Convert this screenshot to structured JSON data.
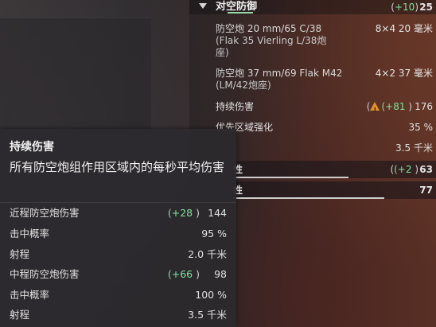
{
  "header": {
    "title": "对空防御",
    "bonus_prefix": "(",
    "bonus": "+10",
    "bonus_suffix": ")",
    "value": "25"
  },
  "guns": [
    {
      "name_line1": "防空炮 20 mm/65 C/38",
      "name_line2": "(Flak 35 Vierling L/38炮",
      "name_line3": "座)",
      "count": "8×4",
      "range": "20 毫米"
    },
    {
      "name_line1": "防空炮 37 mm/69 Flak M42",
      "name_line2": "(LM/42炮座)",
      "count": "4×2",
      "range": "37 毫米"
    }
  ],
  "stats": {
    "continuous_damage": {
      "label": "持续伤害",
      "open": "(",
      "bonus": "(+81",
      "close": ")",
      "value": "176"
    },
    "priority": {
      "label": "优先区域强化",
      "value": "35 %"
    },
    "range_row": {
      "label": "",
      "value": "3.5 千米"
    },
    "maneuverability": {
      "label": "性",
      "bonus": "(+2",
      "close": ")",
      "value": "63"
    },
    "concealment": {
      "label": "性",
      "value": "77"
    }
  },
  "tooltip": {
    "title": "持续伤害",
    "description": "所有防空炮组作用区域内的每秒平均伤害",
    "rows": [
      {
        "label": "近程防空炮伤害",
        "bonus": "(+28",
        "close": ")",
        "value": "144"
      },
      {
        "label": "击中概率",
        "value": "95 %"
      },
      {
        "label": "射程",
        "value": "2.0 千米"
      },
      {
        "label": "中程防空炮伤害",
        "bonus": "(+66",
        "close": ")",
        "value": "98"
      },
      {
        "label": "击中概率",
        "value": "100 %"
      },
      {
        "label": "射程",
        "value": "3.5 千米"
      }
    ]
  }
}
